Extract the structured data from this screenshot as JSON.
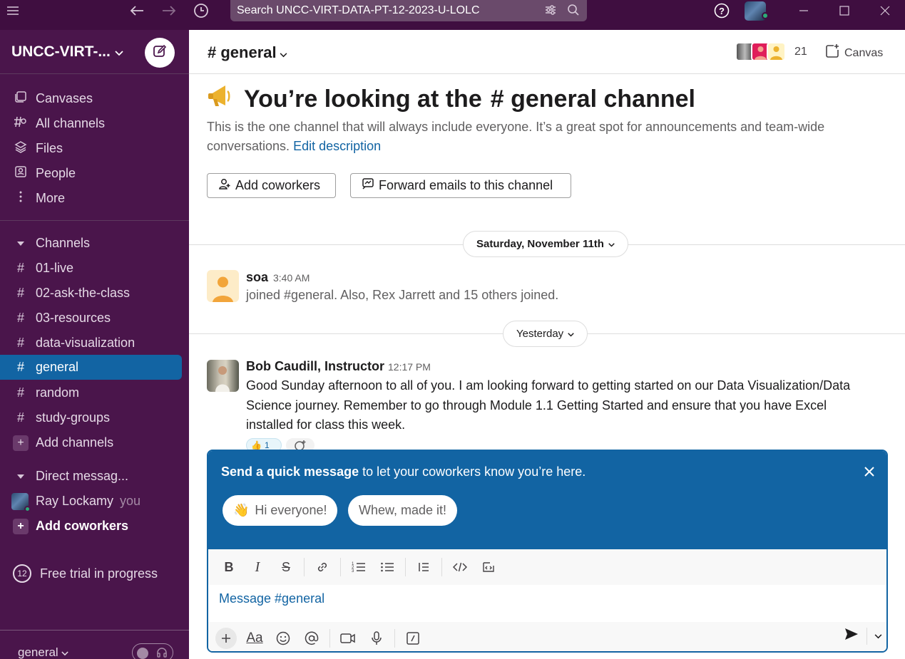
{
  "search": {
    "text": "Search UNCC-VIRT-DATA-PT-12-2023-U-LOLC"
  },
  "workspace": {
    "name": "UNCC-VIRT-..."
  },
  "sidebar": {
    "nav": [
      {
        "label": "Canvases"
      },
      {
        "label": "All channels"
      },
      {
        "label": "Files"
      },
      {
        "label": "People"
      },
      {
        "label": "More"
      }
    ],
    "channels_header": "Channels",
    "channels": [
      {
        "label": "01-live"
      },
      {
        "label": "02-ask-the-class"
      },
      {
        "label": "03-resources"
      },
      {
        "label": "data-visualization"
      },
      {
        "label": "general"
      },
      {
        "label": "random"
      },
      {
        "label": "study-groups"
      }
    ],
    "add_channels": "Add channels",
    "dm_header": "Direct messag...",
    "dm_user": "Ray Lockamy",
    "dm_you": "you",
    "add_coworkers": "Add coworkers",
    "trial_days": "12",
    "trial_text": "Free trial in progress",
    "footer_channel": "general"
  },
  "header": {
    "channel": "# general",
    "member_count": "21",
    "canvas_label": "Canvas"
  },
  "intro": {
    "title_prefix": "You’re looking at the",
    "title_channel": "# general channel",
    "description": "This is the one channel that will always include everyone. It’s a great spot for announcements and team-wide conversations.",
    "edit_link": "Edit description",
    "add_coworkers_btn": "Add coworkers",
    "forward_btn": "Forward emails to this channel"
  },
  "dates": {
    "first": "Saturday, November 11th",
    "second": "Yesterday"
  },
  "messages": [
    {
      "name": "soa",
      "time": "3:40 AM",
      "text": "joined #general. Also, Rex Jarrett and 15 others joined."
    },
    {
      "name": "Bob Caudill, Instructor",
      "time": "12:17 PM",
      "text_line1": "Good Sunday afternoon to all of you. I am looking forward to getting started on our Data Visualization/Data",
      "text_line2": "Science journey. Remember to go through Module 1.1 Getting Started and ensure that you have Excel",
      "text_line3": "installed for class this week.",
      "reaction_count": "1"
    }
  ],
  "quick": {
    "title_bold": "Send a quick message",
    "title_rest": " to let your coworkers know you’re here.",
    "chip1": "Hi everyone!",
    "chip2": "Whew, made it!"
  },
  "composer": {
    "placeholder": "Message #general"
  },
  "colors": {
    "sidebar": "#4a154b",
    "titlebar": "#3f0e40",
    "accent": "#1264a3",
    "presence": "#2bac76"
  }
}
